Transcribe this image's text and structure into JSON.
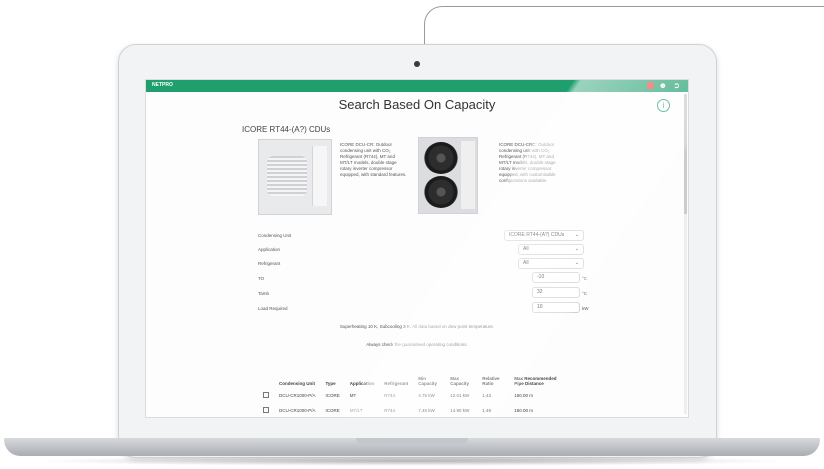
{
  "app": {
    "brand": "NETPRO",
    "page_title": "Search Based On Capacity",
    "section_title": "ICORE RT44-(A?) CDUs"
  },
  "products": [
    {
      "description": "ICORE DCU-CR: Outdoor condensing unit with CO₂ Refrigerant (R744), MT and MT/LT models, double stage rotary inverter compressor equipped, with standard features."
    },
    {
      "description": "ICORE DCU-CRC: Outdoor condensing unit with CO₂ Refrigerant (R744), MT and MT/LT models, double stage rotary inverter compressor equipped, with customisable configurations available."
    }
  ],
  "form": {
    "condensing_unit": {
      "label": "Condensing Unit",
      "value": "ICORE RT44-(A?) CDUs"
    },
    "application": {
      "label": "Application",
      "value": "All"
    },
    "refrigerant": {
      "label": "Refrigerant",
      "value": "All"
    },
    "to": {
      "label": "TO",
      "value": "-10",
      "unit": "°C"
    },
    "tamb": {
      "label": "Tamb",
      "value": "32",
      "unit": "°C"
    },
    "load_required": {
      "label": "Load Required",
      "value": "10",
      "unit": "kW"
    }
  },
  "notes": {
    "superheat": "Superheating 10 K, Subcooling 3 K. All data based on dew point temperature.",
    "guarantee": "Always check the guaranteed operating conditions."
  },
  "table": {
    "headers": [
      "Condensing Unit",
      "Type",
      "Application",
      "Refrigerant",
      "Min Capacity",
      "Max Capacity",
      "Relative Ratio",
      "Max Recommended Pipe Distance"
    ],
    "rows": [
      [
        "DCU-CR1000-P/A",
        "ICORE",
        "MT",
        "R744",
        "4.75 kW",
        "12.01 kW",
        "1.43",
        "150.00 m"
      ],
      [
        "DCU-CR1000-P/A",
        "ICORE",
        "MT/LT",
        "R744",
        "7.45 kW",
        "14.90 kW",
        "1.49",
        "150.00 m"
      ]
    ]
  },
  "icons": [
    "info-icon",
    "alert-icon",
    "user-icon",
    "logout-icon",
    "chevron-down-icon"
  ],
  "colors": {
    "brand": "#1f9e6e",
    "alert": "#e0443e"
  }
}
